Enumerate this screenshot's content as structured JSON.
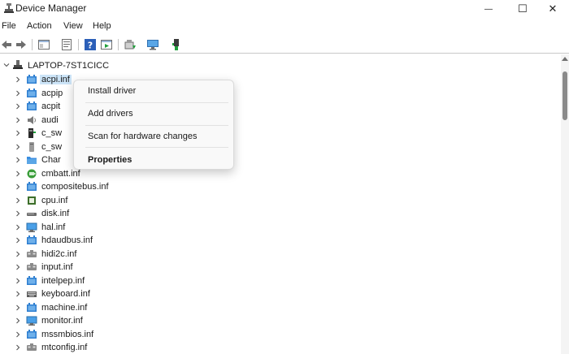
{
  "window": {
    "title": "Device Manager",
    "minimize_glyph": "—",
    "maximize_glyph": "☐",
    "close_glyph": "✕"
  },
  "menu": [
    "File",
    "Action",
    "View",
    "Help"
  ],
  "toolbar": {
    "buttons": [
      "back-arrow-icon",
      "forward-arrow-icon",
      "show-hide-console-tree-icon",
      "properties-icon",
      "help-icon",
      "run-action-icon",
      "update-driver-icon",
      "scan-hardware-icon",
      "add-legacy-hardware-icon"
    ]
  },
  "tree": {
    "root_label": "LAPTOP-7ST1CICC",
    "items": [
      {
        "label": "acpi.inf",
        "icon": "acpi-device-icon"
      },
      {
        "label": "acpip",
        "icon": "acpi-device-icon"
      },
      {
        "label": "acpit",
        "icon": "acpi-device-icon"
      },
      {
        "label": "audi",
        "icon": "audio-speaker-icon"
      },
      {
        "label": "c_sw",
        "icon": "software-component-icon"
      },
      {
        "label": "c_sw",
        "icon": "software-device-icon"
      },
      {
        "label": "Char",
        "icon": "folder-icon"
      },
      {
        "label": "cmbatt.inf",
        "icon": "battery-icon"
      },
      {
        "label": "compositebus.inf",
        "icon": "acpi-device-icon"
      },
      {
        "label": "cpu.inf",
        "icon": "processor-icon"
      },
      {
        "label": "disk.inf",
        "icon": "disk-drive-icon"
      },
      {
        "label": "hal.inf",
        "icon": "monitor-computer-icon"
      },
      {
        "label": "hdaudbus.inf",
        "icon": "acpi-device-icon"
      },
      {
        "label": "hidi2c.inf",
        "icon": "hid-device-icon"
      },
      {
        "label": "input.inf",
        "icon": "hid-device-icon"
      },
      {
        "label": "intelpep.inf",
        "icon": "acpi-device-icon"
      },
      {
        "label": "keyboard.inf",
        "icon": "keyboard-icon"
      },
      {
        "label": "machine.inf",
        "icon": "acpi-device-icon"
      },
      {
        "label": "monitor.inf",
        "icon": "monitor-computer-icon"
      },
      {
        "label": "mssmbios.inf",
        "icon": "acpi-device-icon"
      },
      {
        "label": "mtconfig.inf",
        "icon": "hid-device-icon"
      }
    ]
  },
  "context_menu": {
    "items": [
      "Install driver",
      "Add drivers",
      "Scan for hardware changes",
      "Properties"
    ]
  },
  "colors": {
    "selection": "#cce4f7",
    "device_blue": "#2f7fd1",
    "toolbar_green": "#1e9e3a"
  }
}
